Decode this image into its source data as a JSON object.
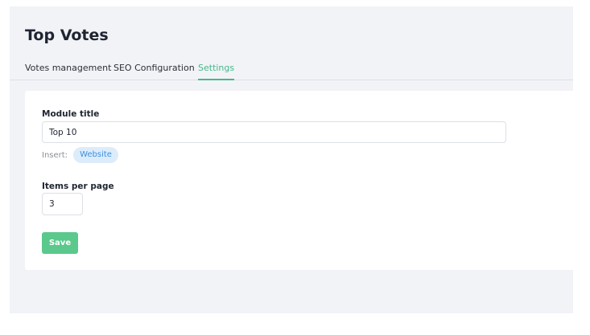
{
  "page": {
    "title": "Top Votes"
  },
  "tabs": [
    {
      "label": "Votes management",
      "active": false
    },
    {
      "label": "SEO Configuration",
      "active": false
    },
    {
      "label": "Settings",
      "active": true
    }
  ],
  "form": {
    "module_title": {
      "label": "Module title",
      "value": "Top 10"
    },
    "insert": {
      "label": "Insert:",
      "chips": [
        "Website"
      ]
    },
    "items_per_page": {
      "label": "Items per page",
      "value": "3"
    },
    "save_label": "Save"
  },
  "colors": {
    "accent": "#45b98a",
    "save_button": "#5bc88c",
    "chip_background": "#dcecfb",
    "chip_text": "#3c8fe0",
    "page_background": "#f2f3f7"
  }
}
